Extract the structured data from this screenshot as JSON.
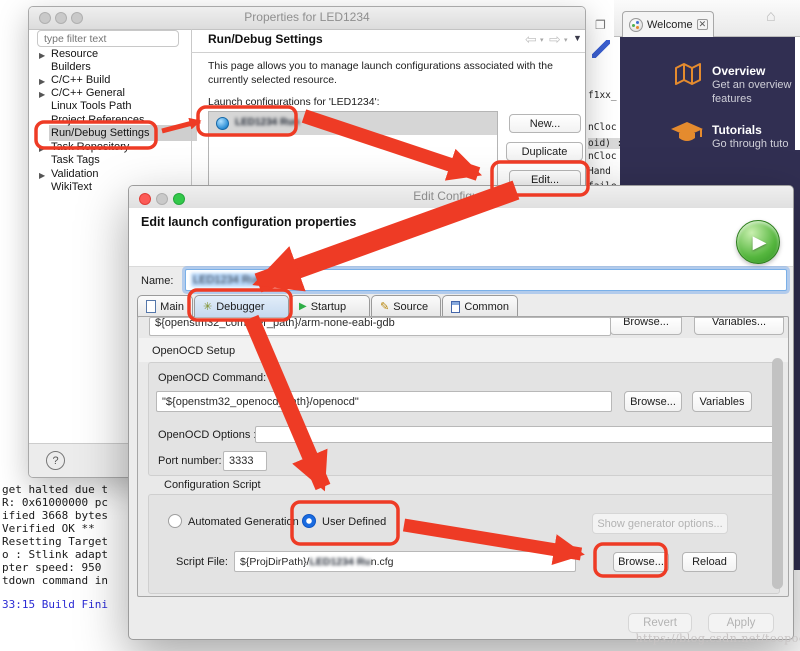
{
  "colors": {
    "annotation_red": "#ee3b25",
    "welcome_bg": "#312f52",
    "welcome_orange": "#e58b2e",
    "radio_selected_blue": "#1a6be0"
  },
  "icons": {
    "help": "?",
    "back_arrow": "⇦",
    "forward_arrow": "⇨",
    "view_menu": "▼",
    "small_caret": "▾",
    "tree_expand": "▶",
    "home": "⌂",
    "close": "✕",
    "play": "▶",
    "debugger_tab": "✳",
    "startup_tab": "▶",
    "source_tab": "✎",
    "maximize": "❐"
  },
  "properties_window": {
    "title": "Properties for LED1234",
    "filter_placeholder": "type filter text",
    "tree": [
      {
        "label": "Resource",
        "expandable": true
      },
      {
        "label": "Builders",
        "expandable": false
      },
      {
        "label": "C/C++ Build",
        "expandable": true
      },
      {
        "label": "C/C++ General",
        "expandable": true
      },
      {
        "label": "Linux Tools Path",
        "expandable": false
      },
      {
        "label": "Project References",
        "expandable": false
      },
      {
        "label": "Run/Debug Settings",
        "expandable": false
      },
      {
        "label": "Task Repository",
        "expandable": true
      },
      {
        "label": "Task Tags",
        "expandable": false
      },
      {
        "label": "Validation",
        "expandable": true
      },
      {
        "label": "WikiText",
        "expandable": false
      }
    ],
    "page_title": "Run/Debug Settings",
    "desc1": "This page allows you to manage launch configurations associated with the",
    "desc2": "currently selected resource.",
    "list_label": "Launch configurations for 'LED1234':",
    "item_name": "LED1234 Run",
    "btn_new": "New...",
    "btn_duplicate": "Duplicate",
    "btn_edit": "Edit..."
  },
  "welcome_view": {
    "tab_label": "Welcome",
    "overview_title": "Overview",
    "overview_line1": "Get an overview",
    "overview_line2": "features",
    "tutorials_title": "Tutorials",
    "tutorials_line1": "Go through tuto"
  },
  "editor_fragments": {
    "lines": [
      "f1xx_",
      "nCloc",
      "oid) :",
      "nCloc",
      "Hand",
      "faile"
    ]
  },
  "console": {
    "lines": [
      "get halted due t",
      "R: 0x61000000 pc",
      "ified 3668 bytes",
      "Verified OK **",
      "Resetting Target",
      "o : Stlink adapt",
      "pter speed: 950",
      "tdown command in"
    ],
    "build_line": "33:15 Build Fini"
  },
  "edit_dialog": {
    "title": "Edit Configuration",
    "header": "Edit launch configuration properties",
    "name_label": "Name:",
    "name_value": "LED1234 Run",
    "tabs": [
      {
        "label": "Main"
      },
      {
        "label": "Debugger"
      },
      {
        "label": "Startup"
      },
      {
        "label": "Source"
      },
      {
        "label": "Common"
      }
    ],
    "gdb_path": "${openstm32_compiler_path}/arm-none-eabi-gdb",
    "top_browse": "Browse...",
    "top_variables": "Variables...",
    "setup": {
      "label": "OpenOCD Setup",
      "command_label": "OpenOCD Command:",
      "command_value": "\"${openstm32_openocd_path}/openocd\"",
      "browse": "Browse...",
      "variables": "Variables",
      "options_label": "OpenOCD Options :",
      "port_label": "Port number:",
      "port_value": "3333"
    },
    "script": {
      "label": "Configuration Script",
      "radio_automated": "Automated Generation",
      "radio_user_defined": "User Defined",
      "generator_btn": "Show generator options...",
      "file_label": "Script File:",
      "file_prefix": "${ProjDirPath}/",
      "file_censored": "LED1234 Ru",
      "file_suffix": "n.cfg",
      "browse": "Browse...",
      "reload": "Reload"
    },
    "revert": "Revert",
    "apply": "Apply"
  },
  "watermark": {
    "text": "https://blog.csdn.net/toopoo"
  }
}
